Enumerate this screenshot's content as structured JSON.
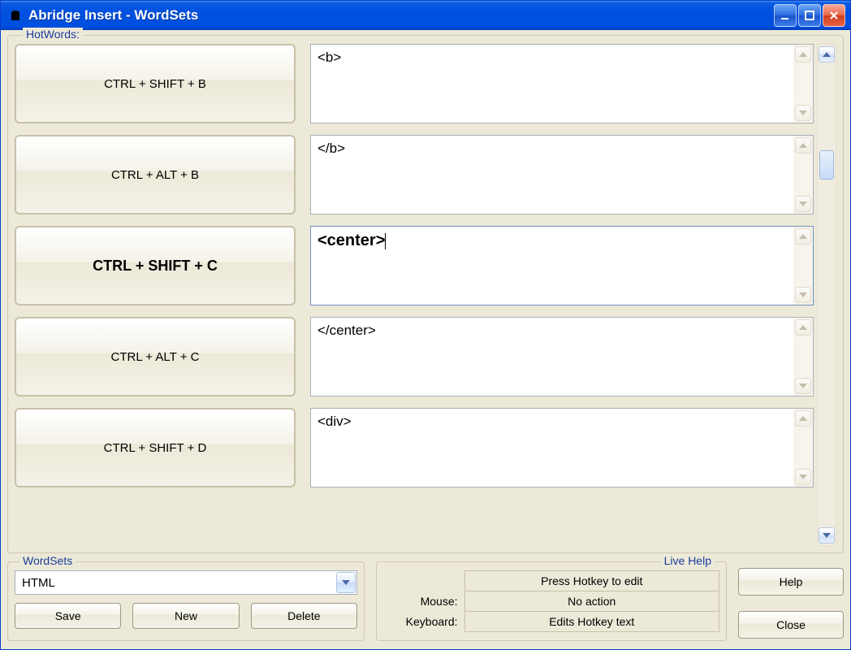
{
  "window": {
    "title": "Abridge Insert - WordSets"
  },
  "hotwords": {
    "label": "HotWords:",
    "rows": [
      {
        "hotkey": "CTRL + SHIFT + B",
        "text": "<b>",
        "selected": false
      },
      {
        "hotkey": "CTRL + ALT + B",
        "text": "</b>",
        "selected": false
      },
      {
        "hotkey": "CTRL + SHIFT + C",
        "text": "<center>",
        "selected": true
      },
      {
        "hotkey": "CTRL + ALT + C",
        "text": "</center>",
        "selected": false
      },
      {
        "hotkey": "CTRL + SHIFT + D",
        "text": "<div>",
        "selected": false
      }
    ]
  },
  "wordsets": {
    "label": "WordSets",
    "selected": "HTML",
    "buttons": {
      "save": "Save",
      "new": "New",
      "delete": "Delete"
    }
  },
  "livehelp": {
    "label": "Live Help",
    "hint": "Press Hotkey to edit",
    "mouse_label": "Mouse:",
    "mouse_value": "No action",
    "keyboard_label": "Keyboard:",
    "keyboard_value": "Edits Hotkey text"
  },
  "side": {
    "help": "Help",
    "close": "Close"
  }
}
